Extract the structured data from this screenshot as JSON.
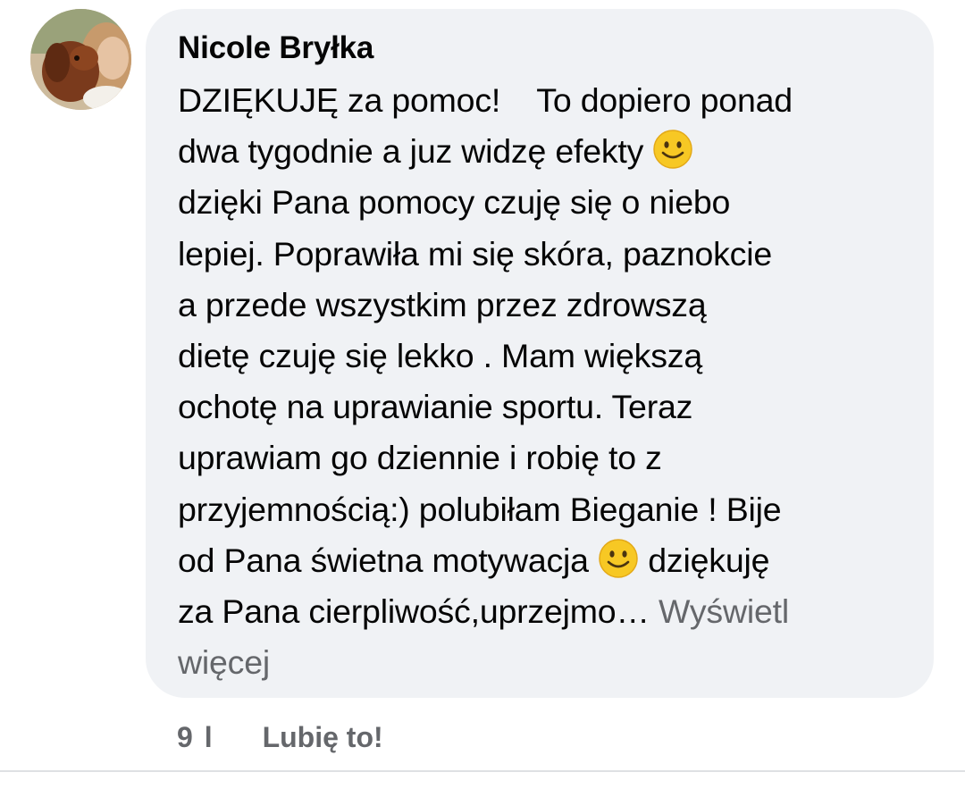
{
  "comment": {
    "author": "Nicole Bryłka",
    "lines": [
      "DZIĘKUJĘ za pomoc!    To dopiero ponad",
      "dwa tygodnie a juz widzę efekty",
      "dzięki Pana pomocy czuję się o niebo",
      "lepiej. Poprawiła mi się skóra, paznokcie",
      "a przede wszystkim przez zdrowszą",
      "dietę czuję się lekko . Mam większą",
      "ochotę na uprawianie sportu. Teraz",
      "uprawiam go dziennie i robię to z",
      "przyjemnością:) polubiłam Bieganie ! Bije",
      "od Pana świetna motywacja",
      "dziękuję",
      "za Pana cierpliwość,uprzejmo…"
    ],
    "see_more_part1": "Wyświetl",
    "see_more_part2": "więcej"
  },
  "footer": {
    "reaction_count": "9 l",
    "like_label": "Lubię to!"
  },
  "icons": {
    "emoji": "slightly-smiling-face-icon"
  }
}
